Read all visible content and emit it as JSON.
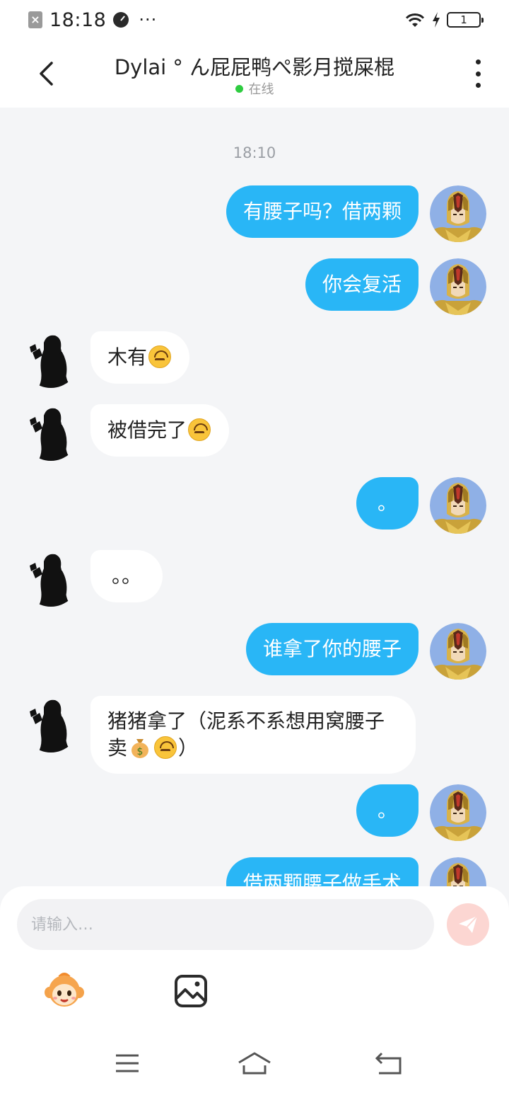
{
  "status_bar": {
    "time": "18:18",
    "dots": "···",
    "battery_level": "1"
  },
  "header": {
    "title": "Dylai ° ん屁屁鸭ぺ影月搅屎棍",
    "status": "在线"
  },
  "chat": {
    "timestamp": "18:10",
    "messages": [
      {
        "side": "out",
        "text": "有腰子吗？借两颗"
      },
      {
        "side": "out",
        "text": "你会复活"
      },
      {
        "side": "in",
        "text": "木有"
      },
      {
        "side": "in",
        "text": "被借完了"
      },
      {
        "side": "out",
        "text": "。"
      },
      {
        "side": "in",
        "text": "。。"
      },
      {
        "side": "out",
        "text": "谁拿了你的腰子"
      },
      {
        "side": "in",
        "text_1": "猪猪拿了（泥系不系想用窝腰子卖",
        "text_2": "）"
      },
      {
        "side": "out",
        "text": "。"
      },
      {
        "side": "out",
        "text": "借两颗腰子做手术"
      }
    ]
  },
  "input": {
    "placeholder": "请输入…"
  },
  "colors": {
    "outgoing_bubble": "#29b6f6",
    "incoming_bubble": "#ffffff",
    "background": "#f4f5f7",
    "send_button": "#fcd6d2",
    "online_dot": "#2ecc40"
  },
  "icons": {
    "back": "chevron-left-icon",
    "more": "more-vertical-icon",
    "send": "paper-plane-icon",
    "sticker": "sticker-icon",
    "image": "image-icon",
    "nav_menu": "menu-icon",
    "nav_home": "home-icon",
    "nav_back": "back-icon"
  }
}
